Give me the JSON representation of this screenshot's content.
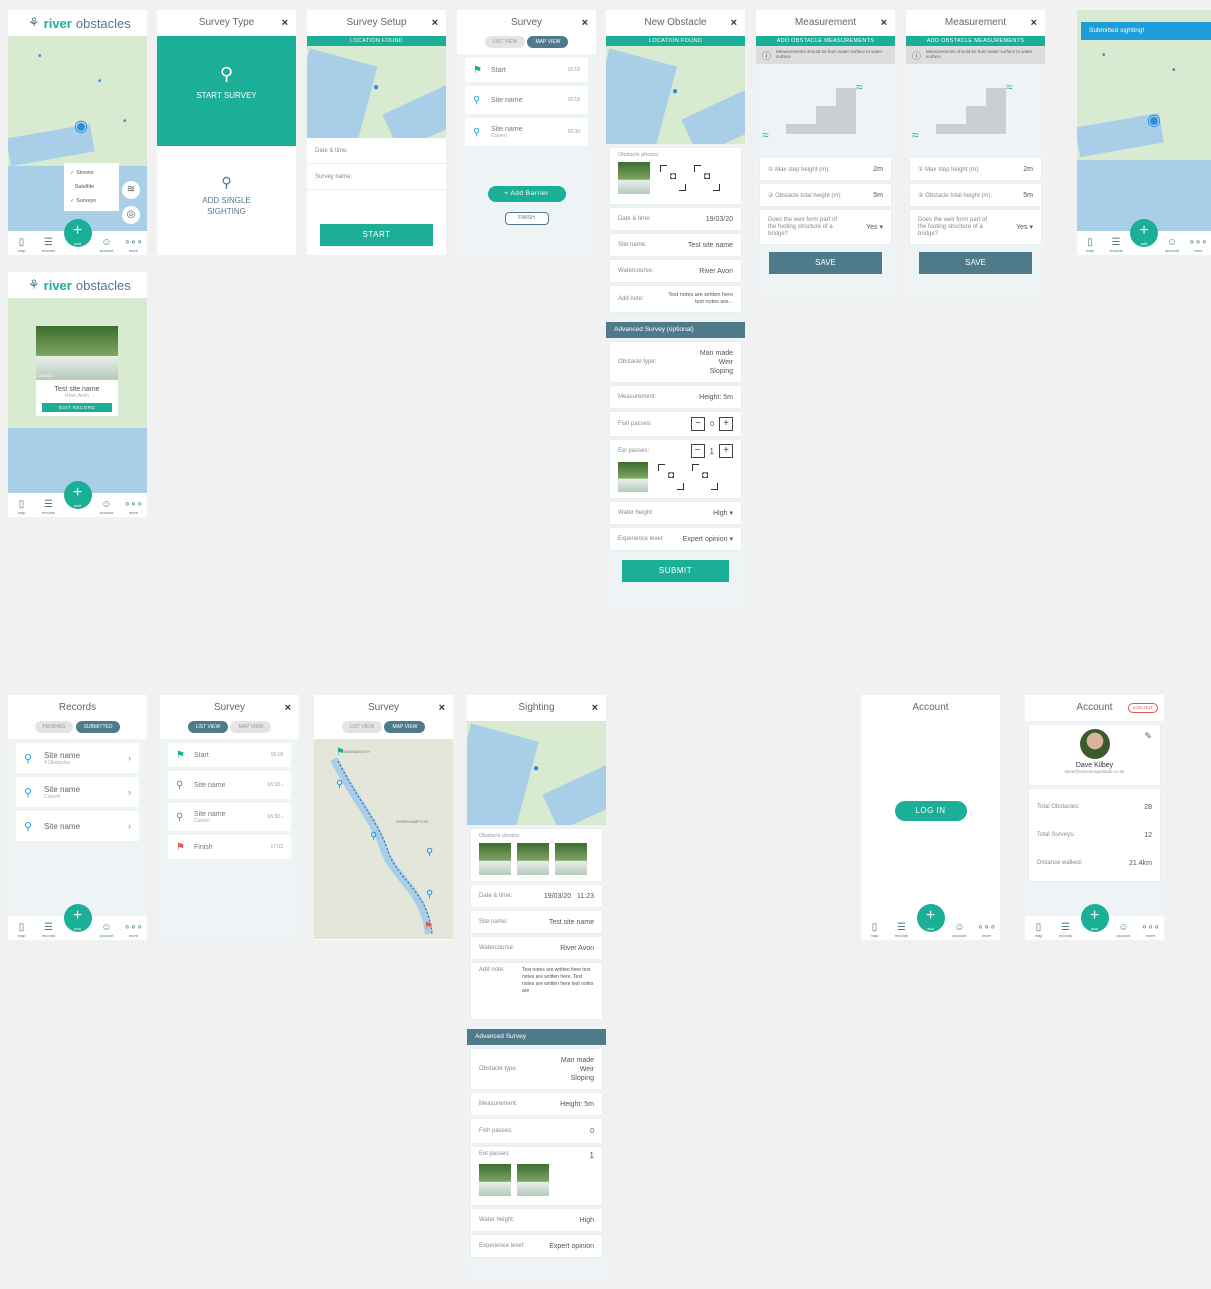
{
  "app": {
    "logo_bold": "river",
    "logo_rest": "obstacles"
  },
  "tabs": {
    "map": "map",
    "records": "records",
    "add": "add",
    "account": "account",
    "more": "more"
  },
  "map_layers": {
    "items": [
      "Streets",
      "Satellite",
      "Surveys"
    ]
  },
  "survey_type": {
    "title": "Survey Type",
    "start": "START SURVEY",
    "single": "ADD SINGLE SIGHTING"
  },
  "survey_setup": {
    "title": "Survey Setup",
    "banner": "LOCATION FOUND",
    "date_label": "Date & time:",
    "name_label": "Survey name:",
    "start": "START"
  },
  "survey_list": {
    "title": "Survey",
    "tab_list": "LIST VIEW",
    "tab_map": "MAP VIEW",
    "add_barrier": "Add Barrier",
    "finish": "FINISH",
    "rows": [
      {
        "label": "Start",
        "time": "16:18"
      },
      {
        "label": "Site name",
        "time": "16:18"
      },
      {
        "label": "Site name",
        "sub": "Culvert",
        "time": "16:30"
      }
    ]
  },
  "new_obstacle": {
    "title": "New Obstacle",
    "banner": "LOCATION FOUND",
    "photos_label": "Obstacle photos:",
    "date_label": "Date & time:",
    "date_value": "19/03/20",
    "site_label": "Site name:",
    "site_value": "Test site name",
    "water_label": "Watercourse:",
    "water_value": "River Avon",
    "note_label": "Add note:",
    "note_value": "Test notes are written here test notes are...",
    "advanced": "Advanced Survey (optional)",
    "type_label": "Obstacle type:",
    "type_value1": "Man made",
    "type_value2": "Weir",
    "type_value3": "Sloping",
    "meas_label": "Measurement:",
    "meas_value": "Height: 5m",
    "fish_label": "Fish passes:",
    "fish_value": "0",
    "eel_label": "Eel passes:",
    "eel_value": "1",
    "wh_label": "Water height:",
    "wh_value": "High",
    "exp_label": "Experience level:",
    "exp_value": "Expert opinion",
    "submit": "SUBMIT"
  },
  "measurement": {
    "title": "Measurement",
    "banner": "ADD OBSTACLE MEASUREMENTS",
    "info": "Measurements should be from water surface to water surface",
    "step_label": "Max step height (m):",
    "step_value": "2m",
    "total_label": "Obstacle total height (m):",
    "total_value": "5m",
    "bridge_q": "Does the weir form part of the footing structure of a bridge?",
    "bridge_a": "Yes",
    "save": "SAVE"
  },
  "submitted": {
    "toast": "Submitted sighting!"
  },
  "popup": {
    "site": "Test site name",
    "water": "River Avon",
    "edit": "EDIT RECORD",
    "date": "19/03/20"
  },
  "records": {
    "title": "Records",
    "pending": "PENDING",
    "submitted": "SUBMITTED",
    "items": [
      {
        "name": "Site name",
        "sub": "4 Obstacles"
      },
      {
        "name": "Site name",
        "sub": "Culvert"
      },
      {
        "name": "Site name",
        "sub": ""
      }
    ]
  },
  "survey2": {
    "title": "Survey",
    "rows": [
      {
        "label": "Start",
        "time": "16:18"
      },
      {
        "label": "Site name",
        "time": "16:18"
      },
      {
        "label": "Site name",
        "sub": "Culvert",
        "time": "16:30"
      },
      {
        "label": "Finish",
        "time": "17:02"
      }
    ]
  },
  "survey_map": {
    "place1": "SHIREHAMPTON",
    "place2": "AVONMOUTH"
  },
  "sighting": {
    "title": "Sighting",
    "photos_label": "Obstacle photos:",
    "date_label": "Date & time:",
    "date_value": "19/03/20   11:23",
    "site_label": "Site name:",
    "site_value": "Test site name",
    "water_label": "Watercourse:",
    "water_value": "River Avon",
    "note_label": "Add note:",
    "note_value": "Test notes are written here test notes are written here. Test notes are written here test notes are",
    "advanced": "Advanced Survey",
    "fish_value": "0",
    "eel_value": "1",
    "wh_value": "High",
    "exp_value": "Expert opinion"
  },
  "account": {
    "title": "Account",
    "login": "LOG IN",
    "logout": "LOG OUT",
    "name": "Dave Kilbey",
    "email": "dave@natural-apptitude.co.uk",
    "stats": [
      {
        "label": "Total Obstacles:",
        "value": "28"
      },
      {
        "label": "Total Surveys:",
        "value": "12"
      },
      {
        "label": "Distance walked:",
        "value": "21.4km"
      }
    ]
  }
}
